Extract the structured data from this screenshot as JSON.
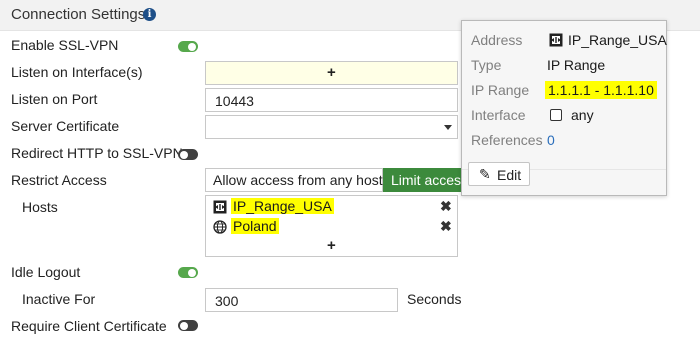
{
  "header": {
    "title": "Connection Settings",
    "info_icon": "info-circle-icon"
  },
  "form": {
    "enable_ssl_vpn": {
      "label": "Enable SSL-VPN",
      "on": true
    },
    "listen_interface": {
      "label": "Listen on Interface(s)",
      "add": "+"
    },
    "listen_port": {
      "label": "Listen on Port",
      "value": "10443"
    },
    "server_certificate": {
      "label": "Server Certificate",
      "value": ""
    },
    "redirect_http": {
      "label": "Redirect HTTP to SSL-VPN",
      "on": false
    },
    "restrict_access": {
      "label": "Restrict Access",
      "options": [
        "Allow access from any host",
        "Limit access"
      ],
      "selected": "Limit access"
    },
    "hosts": {
      "label": "Hosts",
      "items": [
        {
          "name": "IP_Range_USA",
          "icon": "ip-range-icon",
          "remove": "✖"
        },
        {
          "name": "Poland",
          "icon": "globe-icon",
          "remove": "✖"
        }
      ],
      "add": "+"
    },
    "idle_logout": {
      "label": "Idle Logout",
      "on": true
    },
    "inactive_for": {
      "label": "Inactive For",
      "value": "300",
      "unit": "Seconds"
    },
    "require_client_cert": {
      "label": "Require Client Certificate",
      "on": false
    }
  },
  "popup": {
    "address_label": "Address",
    "address_value": "IP_Range_USA",
    "type_label": "Type",
    "type_value": "IP Range",
    "range_label": "IP Range",
    "range_value": "1.1.1.1 - 1.1.1.10",
    "interface_label": "Interface",
    "interface_value": "any",
    "references_label": "References",
    "references_value": "0",
    "edit_label": "Edit"
  },
  "colors": {
    "toggle_on": "#56a84c",
    "active_button": "#3c8a3c",
    "highlight": "#ffff00",
    "link": "#2a6ebb"
  }
}
